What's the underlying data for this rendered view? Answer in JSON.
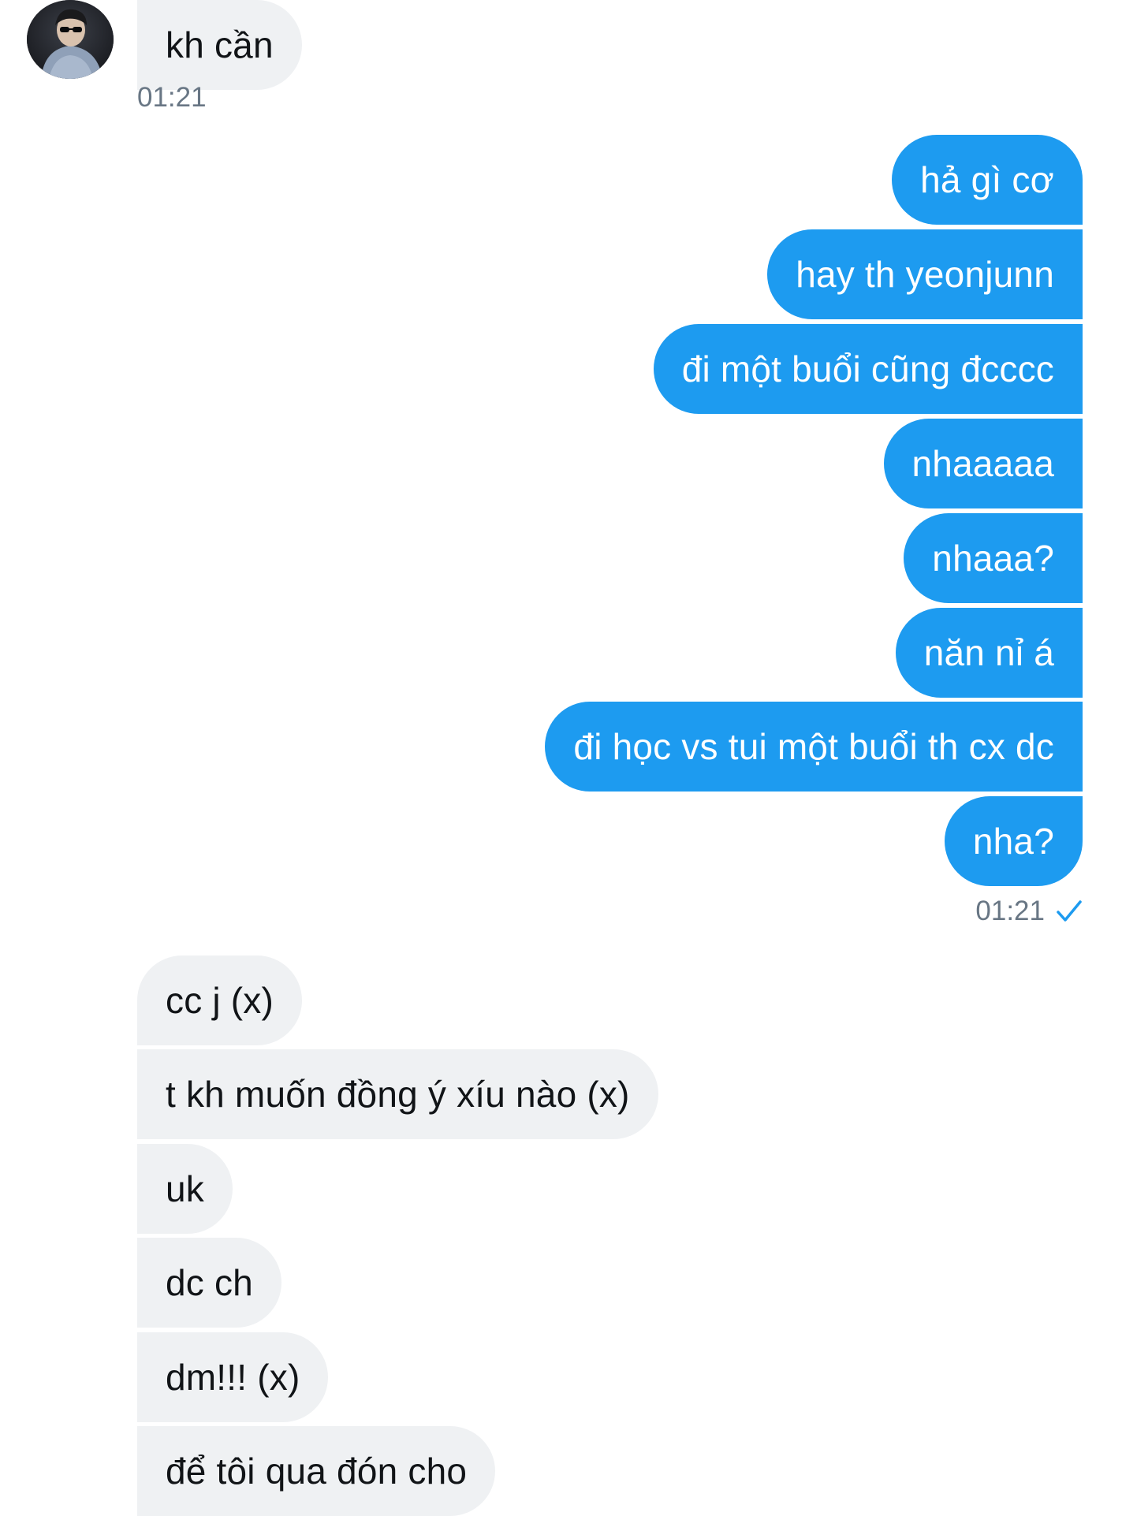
{
  "contact": {
    "avatar_icon": "user-avatar-photo"
  },
  "messages": {
    "incoming_1": [
      "kh cần"
    ],
    "incoming_1_time": "01:21",
    "outgoing": [
      "hả gì cơ",
      "hay th yeonjunn",
      "đi một buổi cũng đcccc",
      "nhaaaaa",
      "nhaaa?",
      "năn nỉ á",
      "đi học vs tui một buổi th cx dc",
      "nha?"
    ],
    "outgoing_time": "01:21",
    "outgoing_status_icon": "read-check-icon",
    "incoming_2": [
      "cc j (x)",
      "t kh muốn đồng ý xíu nào (x)",
      "uk",
      "dc ch",
      "dm!!! (x)",
      "để tôi qua đón cho"
    ]
  },
  "colors": {
    "outgoing_bubble": "#1d9bf0",
    "incoming_bubble": "#eff1f3",
    "timestamp": "#687684",
    "check": "#1d9bf0"
  }
}
